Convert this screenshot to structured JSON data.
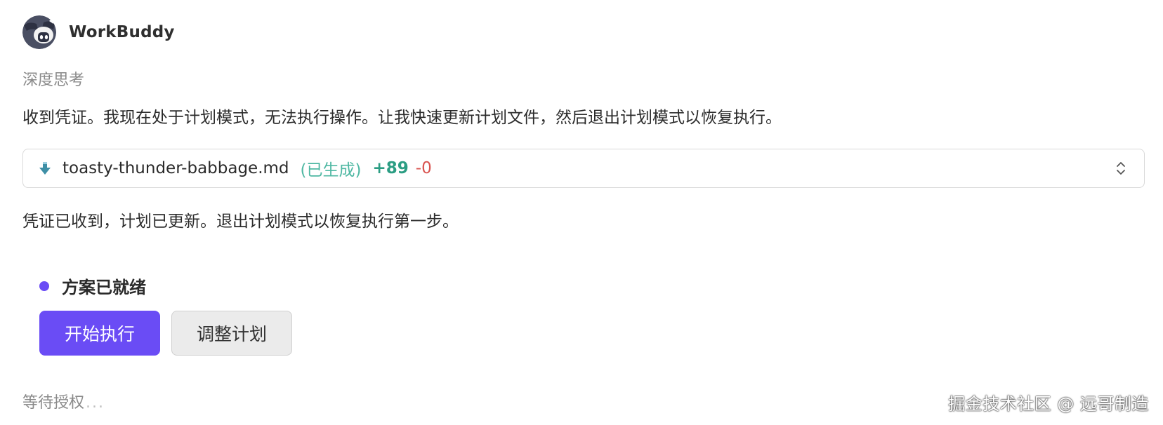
{
  "header": {
    "app_name": "WorkBuddy",
    "avatar_icon": "raccoon-avatar-icon"
  },
  "thinking_label": "深度思考",
  "messages": {
    "first": "收到凭证。我现在处于计划模式，无法执行操作。让我快速更新计划文件，然后退出计划模式以恢复执行。",
    "second": "凭证已收到，计划已更新。退出计划模式以恢复执行第一步。"
  },
  "file_card": {
    "icon": "download-arrow-icon",
    "file_name": "toasty-thunder-babbage.md",
    "status": "(已生成)",
    "additions": "+89",
    "deletions": "-0",
    "expand_icon": "chevron-up-down-icon"
  },
  "plan": {
    "status_label": "方案已就绪",
    "start_button": "开始执行",
    "adjust_button": "调整计划"
  },
  "footer": {
    "waiting_text": "等待授权",
    "waiting_dots": "...",
    "watermark": "掘金技术社区 @ 远哥制造"
  },
  "colors": {
    "accent": "#6a4cf5",
    "additions": "#2b9d83",
    "deletions": "#d9534f",
    "status": "#4fb8a3"
  }
}
